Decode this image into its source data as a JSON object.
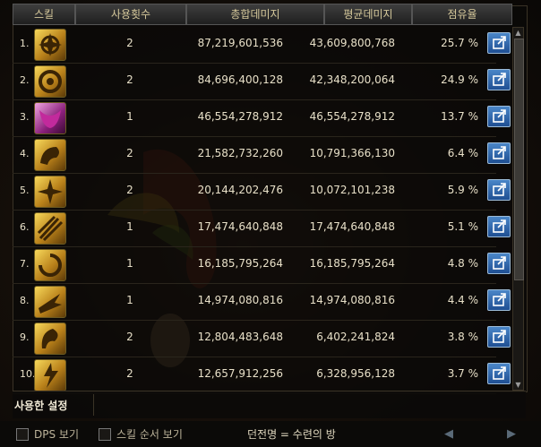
{
  "headers": {
    "skill": "스킬",
    "count": "사용횟수",
    "total": "총합데미지",
    "avg": "평균데미지",
    "share": "점유율"
  },
  "rows": [
    {
      "rank": "1.",
      "count": "2",
      "total": "87,219,601,536",
      "avg": "43,609,800,768",
      "share": "25.7 %",
      "icon": "flame-burst-skill-icon"
    },
    {
      "rank": "2.",
      "count": "2",
      "total": "84,696,400,128",
      "avg": "42,348,200,064",
      "share": "24.9 %",
      "icon": "ring-vortex-skill-icon"
    },
    {
      "rank": "3.",
      "count": "1",
      "total": "46,554,278,912",
      "avg": "46,554,278,912",
      "share": "13.7 %",
      "icon": "pink-butterfly-skill-icon"
    },
    {
      "rank": "4.",
      "count": "2",
      "total": "21,582,732,260",
      "avg": "10,791,366,130",
      "share": "6.4 %",
      "icon": "dragon-head-skill-icon"
    },
    {
      "rank": "5.",
      "count": "2",
      "total": "20,144,202,476",
      "avg": "10,072,101,238",
      "share": "5.9 %",
      "icon": "star-cross-skill-icon"
    },
    {
      "rank": "6.",
      "count": "1",
      "total": "17,474,640,848",
      "avg": "17,474,640,848",
      "share": "5.1 %",
      "icon": "claw-slash-skill-icon"
    },
    {
      "rank": "7.",
      "count": "1",
      "total": "16,185,795,264",
      "avg": "16,185,795,264",
      "share": "4.8 %",
      "icon": "spiral-whirl-skill-icon"
    },
    {
      "rank": "8.",
      "count": "1",
      "total": "14,974,080,816",
      "avg": "14,974,080,816",
      "share": "4.4 %",
      "icon": "blade-rush-skill-icon"
    },
    {
      "rank": "9.",
      "count": "2",
      "total": "12,804,483,648",
      "avg": "6,402,241,824",
      "share": "3.8 %",
      "icon": "fire-dragon-skill-icon"
    },
    {
      "rank": "10.",
      "count": "2",
      "total": "12,657,912,256",
      "avg": "6,328,956,128",
      "share": "3.7 %",
      "icon": "thunder-strike-skill-icon"
    }
  ],
  "settings_tab": "사용한 설정",
  "footer": {
    "dps_label": "DPS 보기",
    "order_label": "스킬 순서 보기",
    "dungeon_label": "던전명 = 수련의 방"
  },
  "colors": {
    "gold": "#d4c79a",
    "text": "#e8e0c8",
    "detail_button": "#2f6db5"
  }
}
